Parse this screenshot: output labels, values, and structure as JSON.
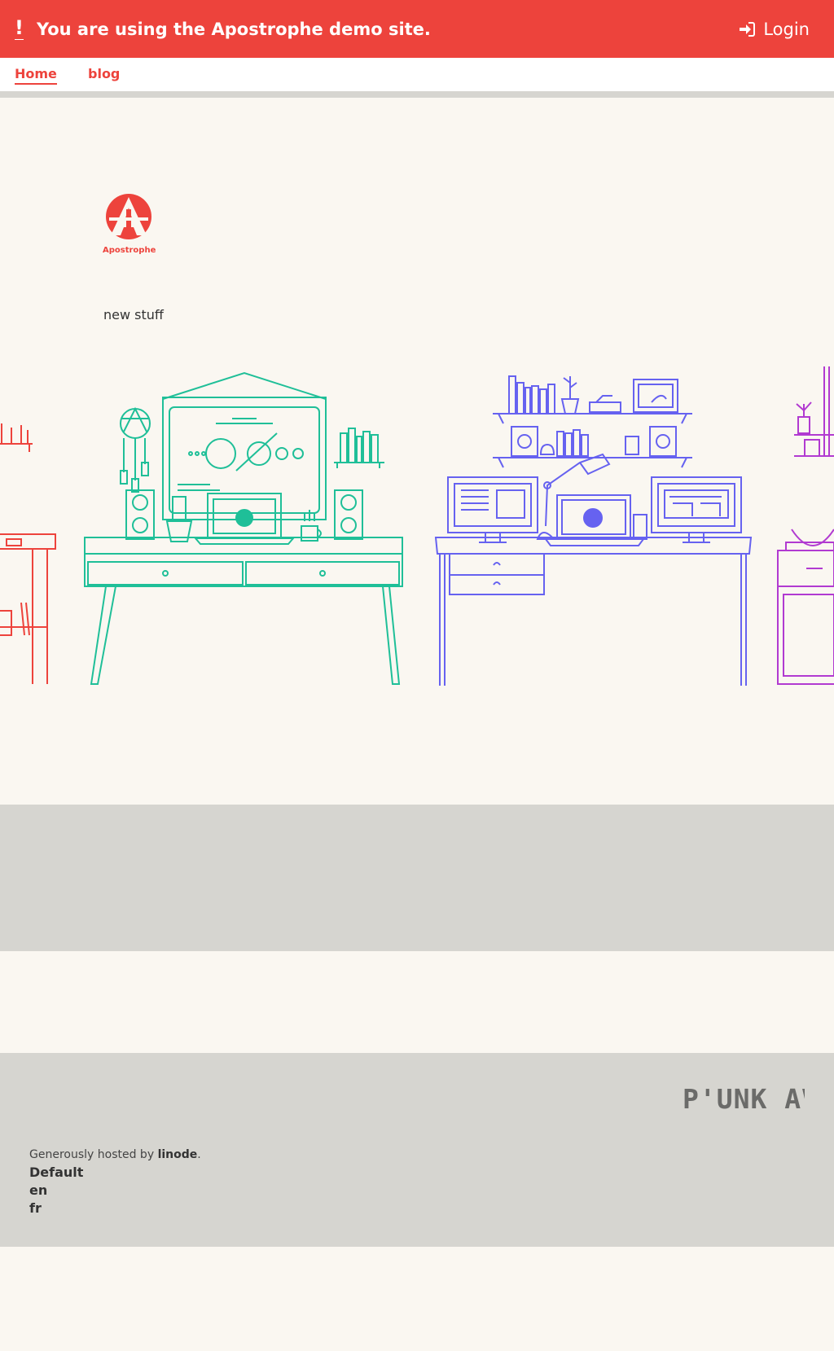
{
  "banner": {
    "alert_mark": "!",
    "message": "You are using the Apostrophe demo site.",
    "login_label": "Login"
  },
  "nav": {
    "items": [
      "Home",
      "blog"
    ],
    "active": "Home"
  },
  "logo": {
    "brand": "Apostrophe"
  },
  "hero": {
    "tagline": "new stuff"
  },
  "footer": {
    "brand": "P'UNK AVE",
    "hosted_prefix": "Generously hosted by ",
    "hosted_link": "linode",
    "hosted_suffix": ".",
    "locales": [
      "Default",
      "en",
      "fr"
    ]
  },
  "colors": {
    "accent": "#ed433c",
    "green": "#1fbf98",
    "blue": "#6662f0",
    "magenta": "#b13ad1",
    "gray": "#d6d5d0"
  }
}
